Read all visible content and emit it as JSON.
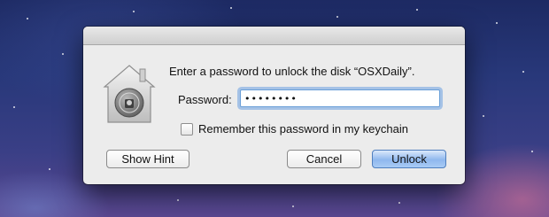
{
  "dialog": {
    "prompt": "Enter a password to unlock the disk “OSXDaily”.",
    "password_label": "Password:",
    "password_value": "••••••••",
    "remember_label": "Remember this password in my keychain",
    "remember_checked": false,
    "buttons": {
      "show_hint": "Show Hint",
      "cancel": "Cancel",
      "unlock": "Unlock"
    },
    "icon": "filevault-lock-icon"
  },
  "colors": {
    "default_button": "#8fb8ee",
    "focus_ring": "#6a9fd8",
    "dialog_bg": "#ececec"
  }
}
